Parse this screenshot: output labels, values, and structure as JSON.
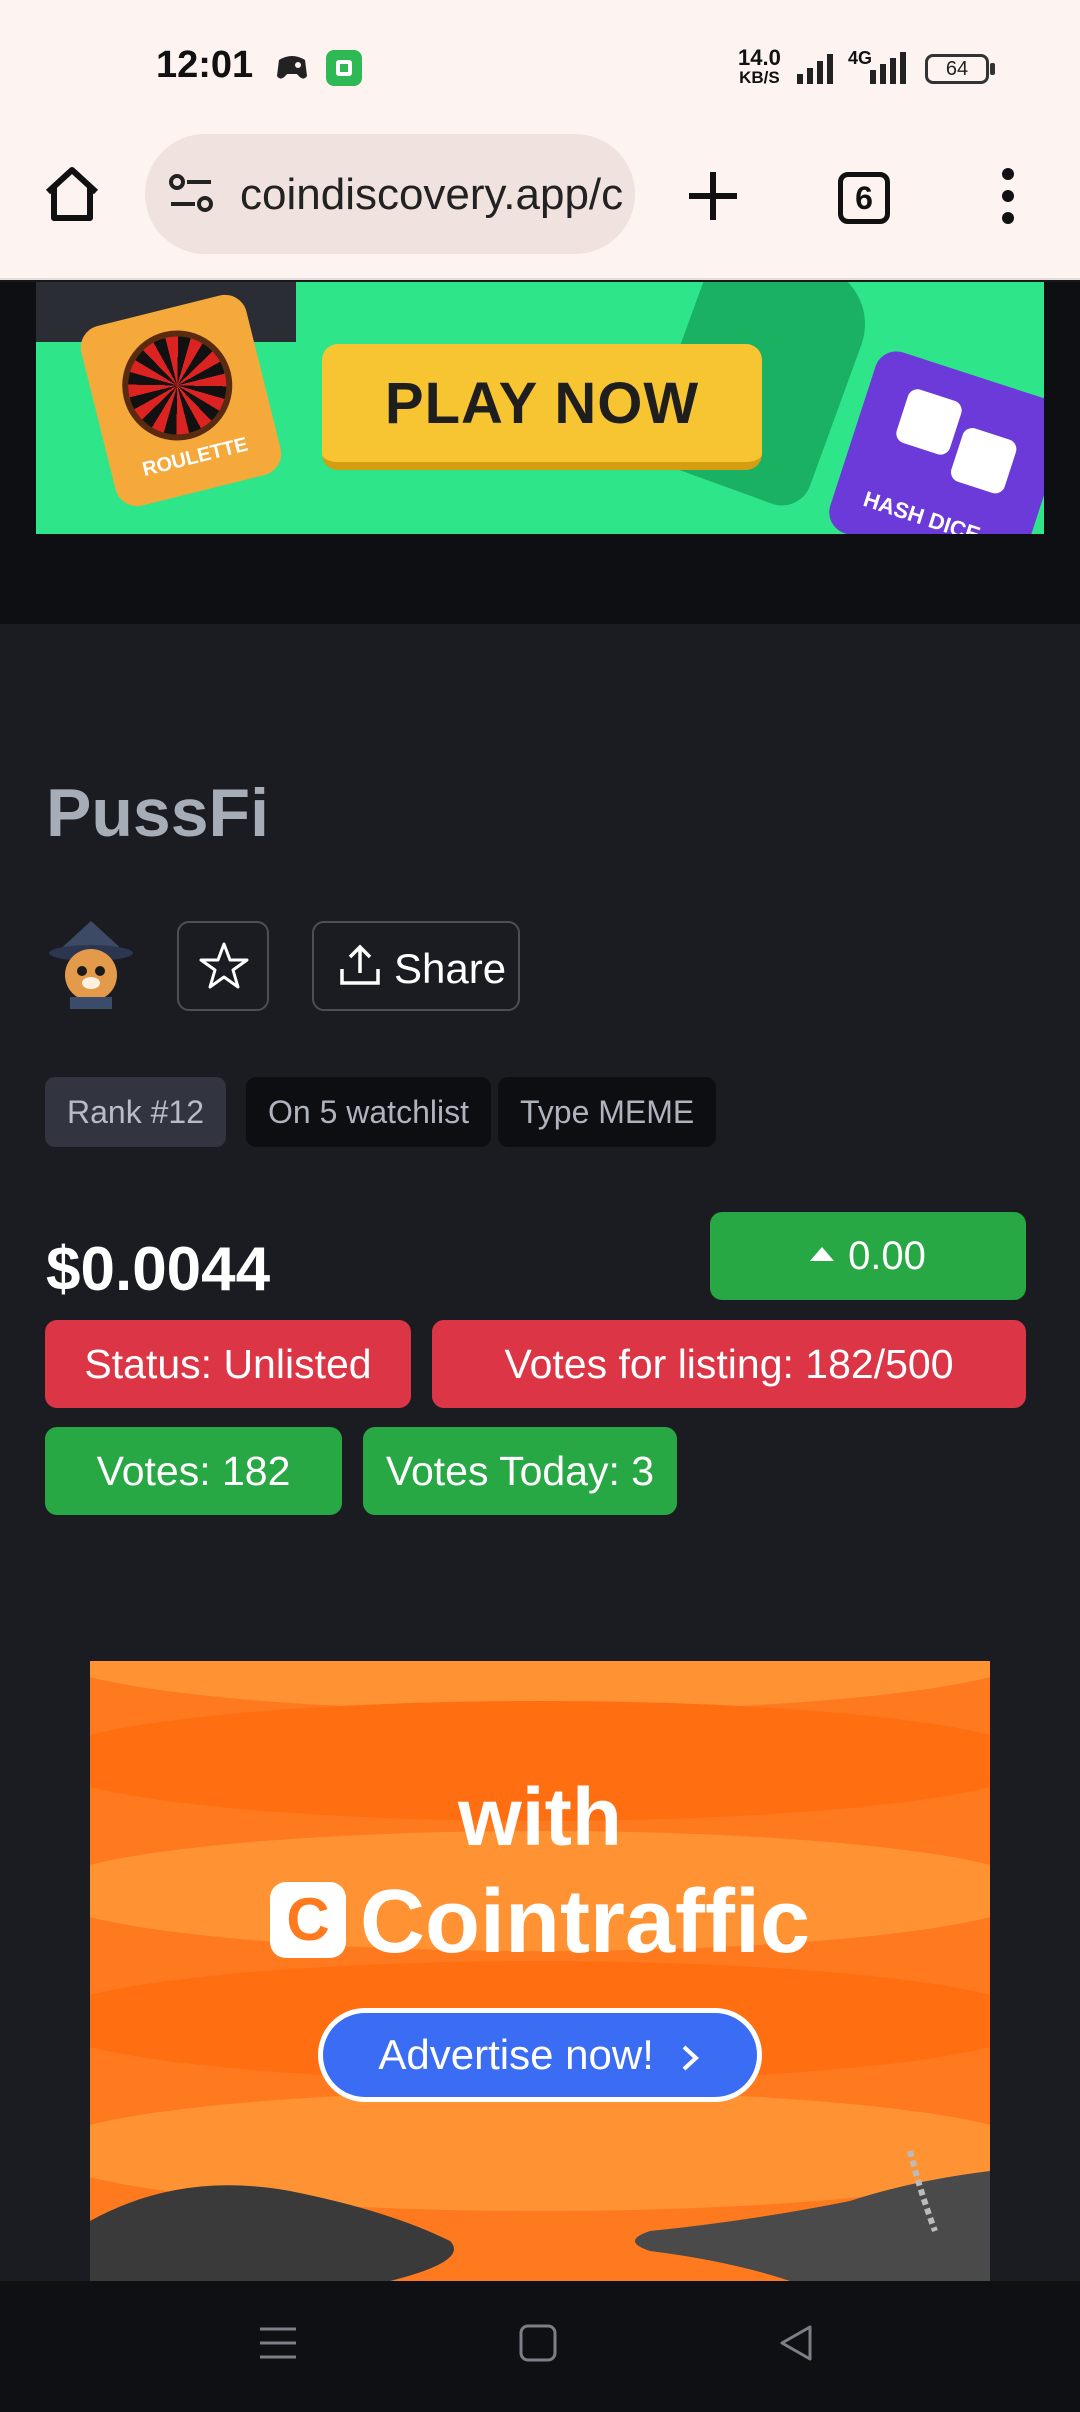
{
  "status_bar": {
    "time": "12:01",
    "net_speed_value": "14.0",
    "net_speed_unit": "KB/S",
    "network": "4G",
    "battery": "64"
  },
  "browser": {
    "url": "coindiscovery.app/c",
    "tab_count": "6"
  },
  "top_banner": {
    "cta": "PLAY NOW",
    "card_left": "ROULETTE",
    "card_right": "HASH DICE"
  },
  "coin": {
    "name": "PussFi",
    "share_label": "Share",
    "badges": {
      "rank": "Rank #12",
      "watchlist": "On 5 watchlist",
      "type": "Type MEME"
    },
    "price": "$0.0044",
    "change": "0.00",
    "status": "Status: Unlisted",
    "votes_for_listing": "Votes for listing: 182/500",
    "votes": "Votes: 182",
    "votes_today": "Votes Today: 3"
  },
  "ad": {
    "line1": "with",
    "brand": "Cointraffic",
    "cta": "Advertise now!"
  },
  "colors": {
    "success": "#28a745",
    "danger": "#dc3545",
    "background": "#1b1c21",
    "ad_orange": "#ff7a1e",
    "ad_button": "#3a6cf4"
  }
}
